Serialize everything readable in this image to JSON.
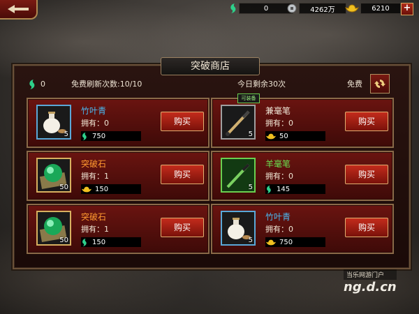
{
  "topbar": {
    "jade": "0",
    "silver": "4262万",
    "gold": "6210"
  },
  "shop": {
    "title": "突破商店",
    "jade_balance": "0",
    "free_refresh": "免费刷新次数:10/10",
    "daily_remaining": "今日剩余30次",
    "free_label": "免费"
  },
  "items": [
    {
      "name": "竹叶青",
      "name_color": "#4ab8f0",
      "owned": "拥有：0",
      "stack": "5",
      "price": "750",
      "currency": "jade",
      "buy": "购买",
      "icon": "wine-jug-icon"
    },
    {
      "name": "兼毫笔",
      "name_color": "#f0e8d8",
      "owned": "拥有：0",
      "stack": "5",
      "price": "50",
      "currency": "gold",
      "buy": "购买",
      "icon": "brush-icon",
      "tag": "可装备"
    },
    {
      "name": "突破石",
      "name_color": "#ff9a30",
      "owned": "拥有：1",
      "stack": "50",
      "price": "150",
      "currency": "gold",
      "buy": "购买",
      "icon": "breakthrough-stone-icon"
    },
    {
      "name": "羊毫笔",
      "name_color": "#6ae050",
      "owned": "拥有：0",
      "stack": "5",
      "price": "145",
      "currency": "jade",
      "buy": "购买",
      "icon": "green-brush-icon"
    },
    {
      "name": "突破石",
      "name_color": "#ff9a30",
      "owned": "拥有：1",
      "stack": "50",
      "price": "150",
      "currency": "jade",
      "buy": "购买",
      "icon": "breakthrough-stone-icon"
    },
    {
      "name": "竹叶青",
      "name_color": "#4ab8f0",
      "owned": "拥有：0",
      "stack": "5",
      "price": "750",
      "currency": "gold",
      "buy": "购买",
      "icon": "wine-jug-icon"
    }
  ],
  "watermark": {
    "line1": "当乐网游门户",
    "line2": "ng.d.cn"
  }
}
